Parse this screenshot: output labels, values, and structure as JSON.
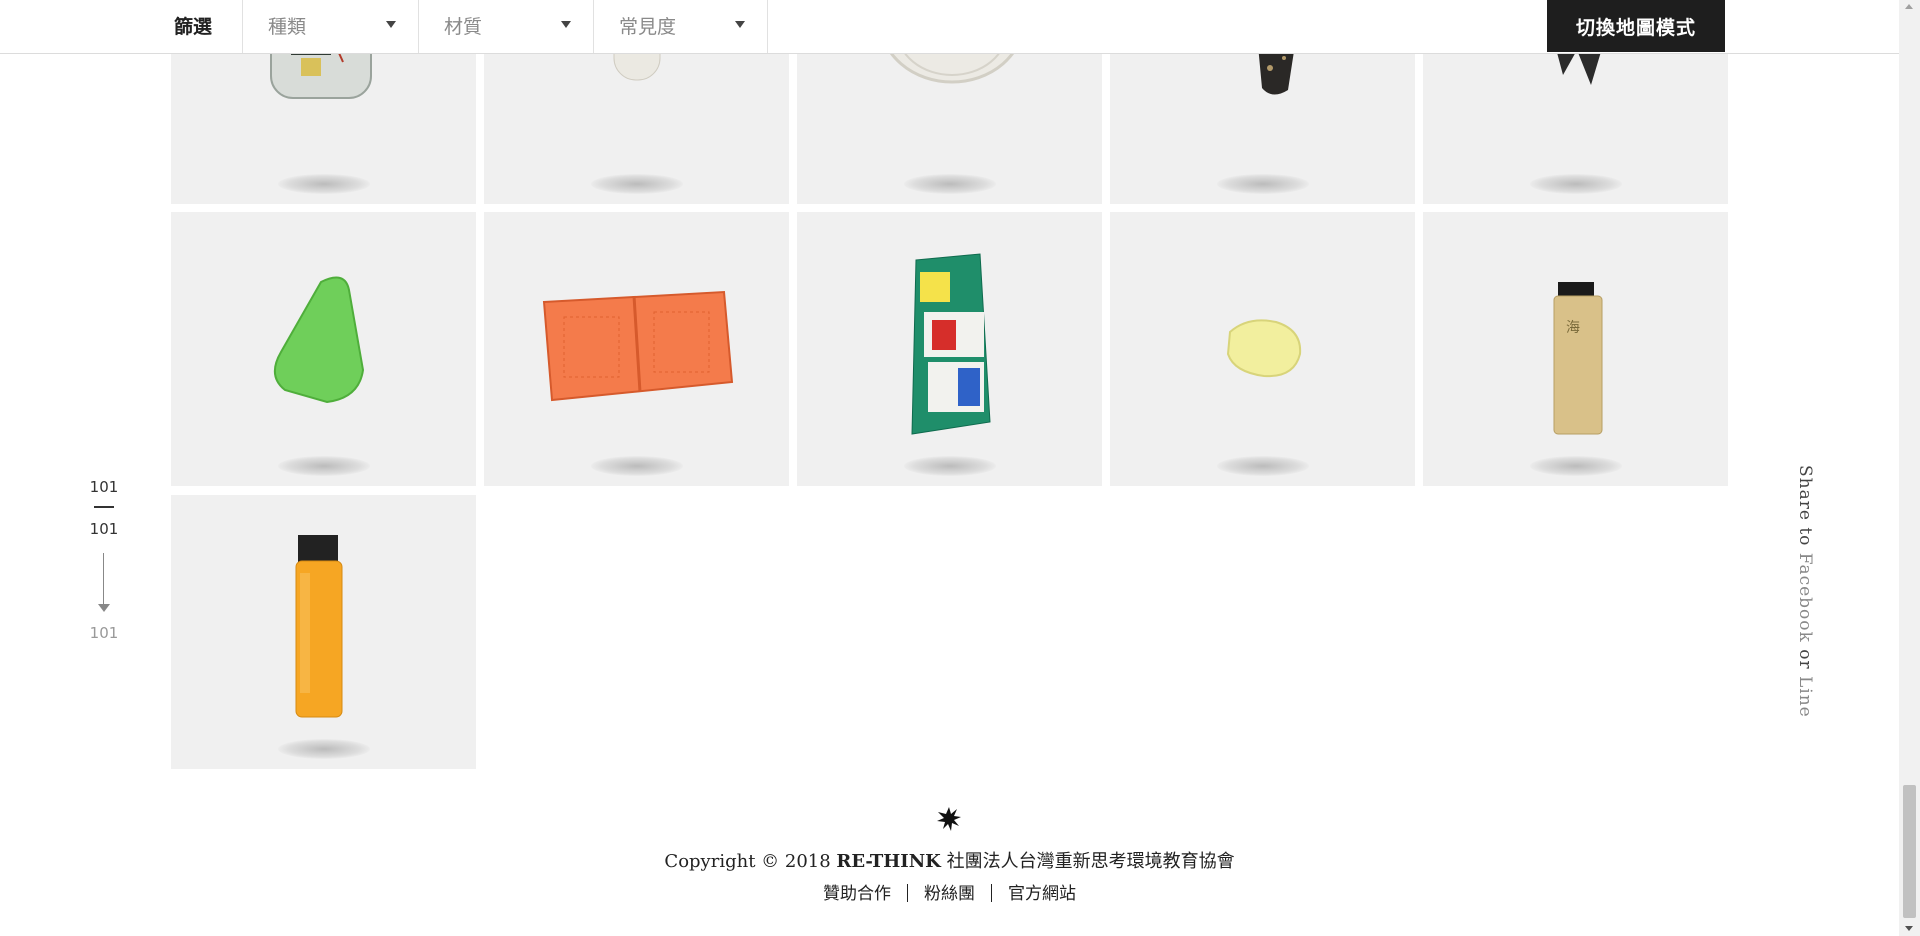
{
  "filter_bar": {
    "label": "篩選",
    "dropdowns": [
      {
        "value": "種類"
      },
      {
        "value": "材質"
      },
      {
        "value": "常見度"
      }
    ],
    "map_toggle_label": "切換地圖模式"
  },
  "items": [
    {
      "name": "bottle-with-electronics"
    },
    {
      "name": "white-plastic-tube"
    },
    {
      "name": "white-plastic-cup"
    },
    {
      "name": "black-sandal"
    },
    {
      "name": "black-crab-claw"
    },
    {
      "name": "green-sea-glass"
    },
    {
      "name": "orange-plastic-basket"
    },
    {
      "name": "snack-wrapper"
    },
    {
      "name": "yellow-resin-stone"
    },
    {
      "name": "beige-lighter"
    },
    {
      "name": "orange-lighter"
    }
  ],
  "counter": {
    "current": "101",
    "total": "101",
    "end": "101"
  },
  "share": {
    "prefix": "Share to ",
    "facebook": "Facebook",
    "or": " or ",
    "line": "Line"
  },
  "footer": {
    "copyright_prefix": "Copyright © 2018 ",
    "copyright_brand": "RE-THINK",
    "copyright_org": " 社團法人台灣重新思考環境教育協會",
    "links": [
      "贊助合作",
      "粉絲團",
      "官方網站"
    ]
  }
}
